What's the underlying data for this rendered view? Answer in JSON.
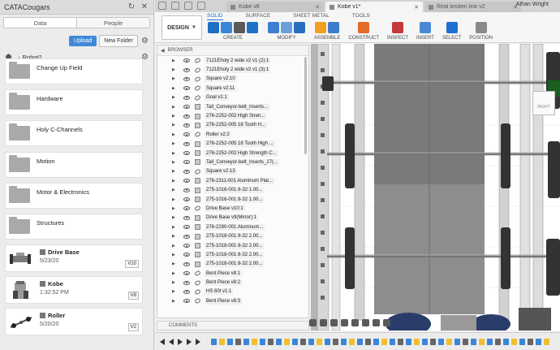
{
  "left_panel": {
    "team_name": "CATACougars",
    "tabs": [
      "Data",
      "People"
    ],
    "upload_label": "Upload",
    "new_folder_label": "New Folder",
    "breadcrumb": "Robot2",
    "folders": [
      "Change Up Field",
      "Hardware",
      "Holy C-Channels",
      "Motion",
      "Motor & Electronics",
      "Structures"
    ],
    "designs": [
      {
        "name": "Drive Base",
        "date": "5/23/20",
        "version": "V10"
      },
      {
        "name": "Kobe",
        "date": "1:32:52 PM",
        "version": "V8"
      },
      {
        "name": "Roller",
        "date": "5/20/20",
        "version": "V2"
      }
    ]
  },
  "app": {
    "tabs": [
      {
        "label": "Kobe v8",
        "active": false
      },
      {
        "label": "Kobe v1*",
        "active": true
      },
      {
        "label": "Real broken link v2",
        "active": false
      }
    ],
    "user": "Athan Wright",
    "design_button": "DESIGN",
    "workspace_tabs": [
      "SOLID",
      "SURFACE",
      "SHEET METAL",
      "TOOLS"
    ],
    "tool_groups": [
      {
        "label": "CREATE",
        "icons": [
          "#1f6fc4",
          "#3b86d6",
          "#5a5a5a",
          "#1e73c9"
        ]
      },
      {
        "label": "MODIFY",
        "icons": [
          "#3e7fcf",
          "#6a9fd8",
          "#2a6fbd"
        ]
      },
      {
        "label": "ASSEMBLE",
        "icons": [
          "#f0a020",
          "#3d7dc9"
        ]
      },
      {
        "label": "CONSTRUCT",
        "icons": [
          "#e46a2a"
        ]
      },
      {
        "label": "INSPECT",
        "icons": [
          "#c43a3a"
        ]
      },
      {
        "label": "INSERT",
        "icons": [
          "#4a8ad4"
        ]
      },
      {
        "label": "SELECT",
        "icons": [
          "#1d6fd1"
        ]
      },
      {
        "label": "POSITION",
        "icons": [
          "#8a8a8a"
        ]
      }
    ],
    "browser_title": "BROWSER",
    "browser_items": [
      {
        "name": "7121Eholy 2 wide v2 v1 (2):1",
        "kind": "link"
      },
      {
        "name": "7121Eholy 2 wide v2 v1 (3):1",
        "kind": "link"
      },
      {
        "name": "Square v2:10",
        "kind": "link"
      },
      {
        "name": "Square v2:11",
        "kind": "link"
      },
      {
        "name": "Goal v1:1",
        "kind": "link"
      },
      {
        "name": "Tall_Conveyor-belt_Inserts...",
        "kind": "comp"
      },
      {
        "name": "276-2252-002 High Stren...",
        "kind": "comp"
      },
      {
        "name": "276-2252-005 18 Tooth H...",
        "kind": "comp"
      },
      {
        "name": "Roller v2:2",
        "kind": "link"
      },
      {
        "name": "276-2252-005 18 Tooth High ...",
        "kind": "comp"
      },
      {
        "name": "276-2252-002 High Strength C...",
        "kind": "comp"
      },
      {
        "name": "Tall_Conveyor-belt_Inserts_27(...",
        "kind": "comp"
      },
      {
        "name": "Square v2:13",
        "kind": "link"
      },
      {
        "name": "276-2311-001 Aluminum Plat...",
        "kind": "comp"
      },
      {
        "name": "275-1016-001 8-32 1.00...",
        "kind": "comp"
      },
      {
        "name": "275-1016-001 8-32 1.00...",
        "kind": "comp"
      },
      {
        "name": "Drive Base v10:1",
        "kind": "link"
      },
      {
        "name": "Drive Base v9(Mirror):1",
        "kind": "comp"
      },
      {
        "name": "276-2290-001 Aluminum...",
        "kind": "comp"
      },
      {
        "name": "275-1018-001 8-32 2.00...",
        "kind": "comp"
      },
      {
        "name": "275-1018-001 8-32 2.00...",
        "kind": "comp"
      },
      {
        "name": "275-1018-001 8-32 2.00...",
        "kind": "comp"
      },
      {
        "name": "275-1018-001 8-32 2.00...",
        "kind": "comp"
      },
      {
        "name": "Bent Piece v8:1",
        "kind": "link"
      },
      {
        "name": "Bent Piece v8:2",
        "kind": "link"
      },
      {
        "name": "HS 60t v1:1",
        "kind": "link"
      },
      {
        "name": "Bent Piece v8:3",
        "kind": "link"
      }
    ],
    "comments_label": "COMMENTS",
    "viewcube_label": "RIGHT"
  }
}
